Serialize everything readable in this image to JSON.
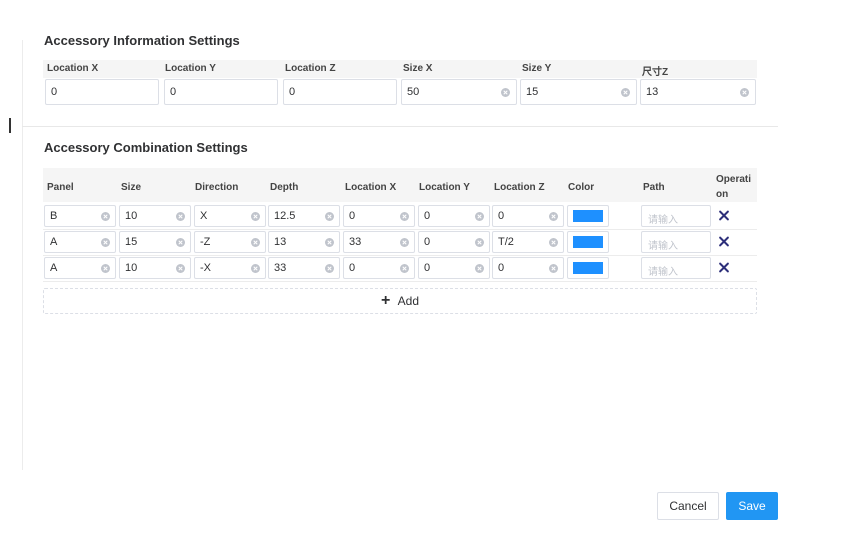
{
  "accessory_info": {
    "title": "Accessory Information Settings",
    "fields": [
      {
        "label": "Location X",
        "value": "0",
        "clearable": false
      },
      {
        "label": "Location Y",
        "value": "0",
        "clearable": false
      },
      {
        "label": "Location Z",
        "value": "0",
        "clearable": false
      },
      {
        "label": "Size X",
        "value": "50",
        "clearable": true
      },
      {
        "label": "Size Y",
        "value": "15",
        "clearable": true
      },
      {
        "label": "尺寸Z",
        "value": "13",
        "clearable": true
      }
    ]
  },
  "accessory_combination": {
    "title": "Accessory Combination Settings",
    "columns": [
      "Panel",
      "Size",
      "Direction",
      "Depth",
      "Location X",
      "Location Y",
      "Location Z",
      "Color",
      "Path",
      "Operati on"
    ],
    "path_placeholder": "请输入",
    "rows": [
      {
        "panel": "B",
        "size": "10",
        "direction": "X",
        "depth": "12.5",
        "location_x": "0",
        "location_y": "0",
        "location_z": "0",
        "color": "#1e90ff"
      },
      {
        "panel": "A",
        "size": "15",
        "direction": "-Z",
        "depth": "13",
        "location_x": "33",
        "location_y": "0",
        "location_z": "T/2",
        "color": "#1e90ff"
      },
      {
        "panel": "A",
        "size": "10",
        "direction": "-X",
        "depth": "33",
        "location_x": "0",
        "location_y": "0",
        "location_z": "0",
        "color": "#1e90ff"
      }
    ],
    "add_label": "Add"
  },
  "footer": {
    "cancel_label": "Cancel",
    "save_label": "Save"
  },
  "colors": {
    "accent": "#2196f3",
    "delete_icon": "#2d2f7a"
  }
}
